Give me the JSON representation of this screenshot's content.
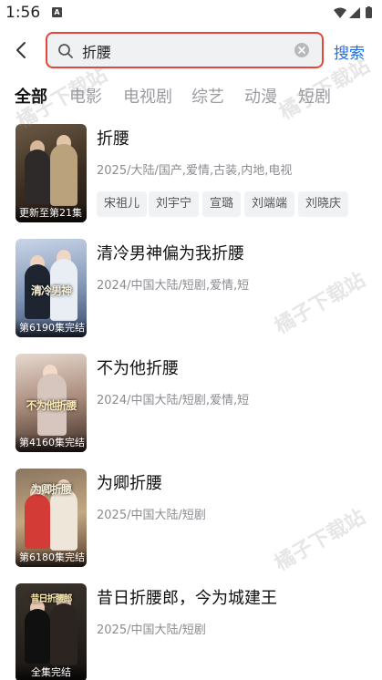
{
  "status_bar": {
    "time": "1:56",
    "notification_letter": "A"
  },
  "search": {
    "query": "折腰",
    "submit_label": "搜索"
  },
  "tabs": [
    {
      "label": "全部",
      "active": true
    },
    {
      "label": "电影",
      "active": false
    },
    {
      "label": "电视剧",
      "active": false
    },
    {
      "label": "综艺",
      "active": false
    },
    {
      "label": "动漫",
      "active": false
    },
    {
      "label": "短剧",
      "active": false
    }
  ],
  "results": [
    {
      "title": "折腰",
      "meta": "2025/大陆/国产,爱情,古装,内地,电视",
      "badge": "更新至第21集",
      "poster_text": "",
      "cast": [
        "宋祖儿",
        "刘宇宁",
        "宣璐",
        "刘端端",
        "刘晓庆"
      ]
    },
    {
      "title": "清冷男神偏为我折腰",
      "meta": "2024/中国大陆/短剧,爱情,短",
      "badge": "第6190集完结",
      "poster_text": "清冷男神",
      "cast": []
    },
    {
      "title": "不为他折腰",
      "meta": "2024/中国大陆/短剧,爱情,短",
      "badge": "第4160集完结",
      "poster_text": "不为他折腰",
      "cast": []
    },
    {
      "title": "为卿折腰",
      "meta": "2025/中国大陆/短剧",
      "badge": "第6180集完结",
      "poster_text": "为卿折腰",
      "cast": []
    },
    {
      "title": "昔日折腰郎，今为城建王",
      "meta": "2025/中国大陆/短剧",
      "badge": "全集完结",
      "poster_text": "昔日折腰郎",
      "cast": []
    }
  ],
  "watermark_text": "橘子下载站",
  "colors": {
    "accent_blue": "#1f6ee6",
    "highlight_red": "#e5463b"
  },
  "icons": {
    "back": "chevron-left-icon",
    "search": "magnifier-icon",
    "clear": "close-circle-icon",
    "wifi": "wifi-icon",
    "signal": "signal-icon",
    "battery": "battery-icon"
  }
}
